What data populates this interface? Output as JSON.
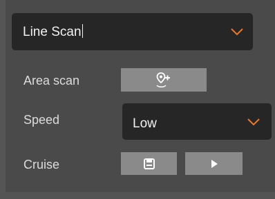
{
  "scan_mode_select": {
    "selected": "Line Scan"
  },
  "area_scan": {
    "label": "Area scan",
    "button_icon": "add-location-icon"
  },
  "speed": {
    "label": "Speed",
    "selected": "Low"
  },
  "cruise": {
    "label": "Cruise",
    "save_icon": "save-icon",
    "play_icon": "play-icon"
  },
  "colors": {
    "panel_bg": "#4a4a4a",
    "select_bg": "#262626",
    "button_bg": "#8a8a8a",
    "chevron": "#e8782a",
    "text": "#f2f2f2"
  }
}
